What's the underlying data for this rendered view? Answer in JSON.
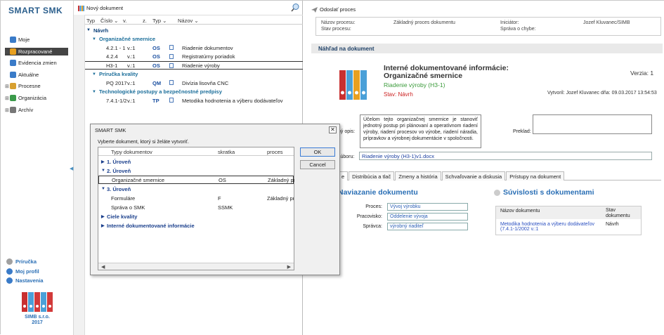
{
  "brand": "SMART SMK",
  "sidebar": {
    "items": [
      {
        "label": "Moje",
        "exp": ""
      },
      {
        "label": "Rozpracované",
        "exp": "⊞",
        "active": true
      },
      {
        "label": "Evidencia zmien",
        "exp": ""
      },
      {
        "label": "Aktuálne",
        "exp": ""
      },
      {
        "label": "Procesne",
        "exp": "⊞"
      },
      {
        "label": "Organizácia",
        "exp": "⊞"
      },
      {
        "label": "Archív",
        "exp": "⊞"
      }
    ],
    "bottom": [
      {
        "label": "Príručka"
      },
      {
        "label": "Moj profil"
      },
      {
        "label": "Nastavenia"
      }
    ],
    "company_name": "SIMB s.r.o.",
    "company_year": "2017"
  },
  "center": {
    "new_doc_label": "Nový dokument",
    "columns": {
      "typ": "Typ",
      "cislo": "Číslo",
      "v": "v.",
      "z": "z.",
      "typ2": "Typ",
      "nazov": "Názov"
    },
    "rows": [
      {
        "kind": "top",
        "label": "Návrh"
      },
      {
        "kind": "grp",
        "label": "Organizačné smernice"
      },
      {
        "kind": "doc",
        "cislo": "4.2.1 - 1",
        "v": "v.:1",
        "typ": "OS",
        "nazov": "Riadenie dokumentov"
      },
      {
        "kind": "doc",
        "cislo": "4.2.4",
        "v": "v.:1",
        "typ": "OS",
        "nazov": "Registratúrny poriadok"
      },
      {
        "kind": "doc",
        "cislo": "H3-1",
        "v": "v.:1",
        "typ": "OS",
        "nazov": "Riadenie výroby",
        "hl": true
      },
      {
        "kind": "grp",
        "label": "Príručka kvality"
      },
      {
        "kind": "doc",
        "cislo": "PQ 2017",
        "v": "v.:1",
        "typ": "QM",
        "nazov": "Divízia lisovňa CNC"
      },
      {
        "kind": "grp",
        "label": "Technologické postupy a bezpečnostné predpisy"
      },
      {
        "kind": "doc",
        "cislo": "7.4.1-1/2",
        "v": "v.:1",
        "typ": "TP",
        "nazov": "Metodika hodnotenia a výberu dodávateľov"
      }
    ]
  },
  "right": {
    "send_label": "Odoslať proces",
    "info": {
      "nazov_procesu_lbl": "Názov procesu:",
      "nazov_procesu_val": "Základný proces dokumentu",
      "stav_procesu_lbl": "Stav procesu:",
      "iniciator_lbl": "Iniciátor:",
      "iniciator_val": "Jozef Kluvanec/SIMB",
      "sprava_lbl": "Správa o chybe:"
    },
    "nahlad": "Náhľad na dokument",
    "title_line1": "Interné dokumentované informácie:",
    "title_line2": "Organizačné smernice",
    "subtitle": "Riadenie výroby (H3-1)",
    "stav": "Stav: Návrh",
    "verzia": "Verzia: 1",
    "vytvoril": "Vytvoril: Jozef Kluvanec dňa: 09.03.2017 13:54:53",
    "opis_lbl": "ný opis:",
    "opis": "Účelom tejto organizačnej smernice je stanoviť jednotný postup pri plánovaní a operatívnom riadení výroby, riadení procesov vo výrobe, riadení náradia, prípravkov a výrobnej dokumentácie v spoločnosti.",
    "preklad_lbl": "Preklad:",
    "subor_lbl": "súboru:",
    "subor": "Riadenie výroby (H3-1)v1.docx",
    "tabs": [
      "e",
      "Distribúcia a tlač",
      "Zmeny a história",
      "Schvaľovanie a diskusia",
      "Prístupy na dokument"
    ],
    "naviazanie_title": "Naviazanie dokumentu",
    "proces_lbl": "Proces:",
    "proces_val": "Vývoj výrobku",
    "pracovisko_lbl": "Pracovisko:",
    "pracovisko_val": "Oddelenie vývoja",
    "spravca_lbl": "Správca:",
    "spravca_val": "výrobný riaditeľ",
    "suvislosti_title": "Súvislosti s dokumentami",
    "suv_col1": "Názov dokumentu",
    "suv_col2a": "Stav",
    "suv_col2b": "dokumentu",
    "suv_row_name1": "Metodika hodnotenia a výberu dodávateľov",
    "suv_row_name2": "(7.4.1-1/2002 v.:1",
    "suv_row_stav": "Návrh"
  },
  "dialog": {
    "title": "SMART SMK",
    "close": "✕",
    "prompt": "Vyberte dokument, ktorý si želáte vytvoriť.",
    "columns": {
      "typy": "Typy dokumentov",
      "skratka": "skratka",
      "proces": "proces"
    },
    "rows": [
      {
        "kind": "grp",
        "arrow": "▶",
        "label": "1. Úroveň"
      },
      {
        "kind": "grp",
        "arrow": "▼",
        "label": "2. Úroveň"
      },
      {
        "kind": "item",
        "label": "Organizačné smernice",
        "skratka": "OS",
        "proces": "Základný pr",
        "sel": true
      },
      {
        "kind": "grp",
        "arrow": "▼",
        "label": "3. Úroveň"
      },
      {
        "kind": "item",
        "label": "Formuláre",
        "skratka": "F",
        "proces": "Základný pr"
      },
      {
        "kind": "item",
        "label": "Správa o SMK",
        "skratka": "SSMK",
        "proces": ""
      },
      {
        "kind": "grp",
        "arrow": "▶",
        "label": "Ciele kvality"
      },
      {
        "kind": "grp",
        "arrow": "▶",
        "label": "Interné dokumentované informácie"
      }
    ],
    "ok": "OK",
    "cancel": "Cancel"
  }
}
